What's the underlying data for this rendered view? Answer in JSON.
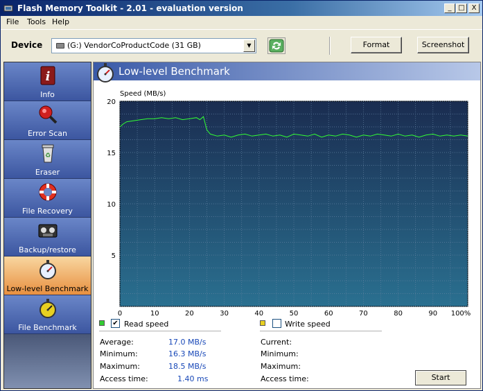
{
  "window": {
    "title": "Flash Memory Toolkit - 2.01 - evaluation version",
    "controls": [
      "_",
      "□",
      "X"
    ]
  },
  "menu": [
    "File",
    "Tools",
    "Help"
  ],
  "toolbar": {
    "device_label": "Device",
    "device_value": "(G:) VendorCoProductCode (31 GB)",
    "format_label": "Format",
    "screenshot_label": "Screenshot"
  },
  "sidebar": {
    "items": [
      {
        "label": "Info",
        "icon": "info-icon"
      },
      {
        "label": "Error Scan",
        "icon": "magnifier-icon"
      },
      {
        "label": "Eraser",
        "icon": "recycle-bin-icon"
      },
      {
        "label": "File Recovery",
        "icon": "lifebuoy-icon"
      },
      {
        "label": "Backup/restore",
        "icon": "tape-icon"
      },
      {
        "label": "Low-level Benchmark",
        "icon": "stopwatch-icon",
        "active": true
      },
      {
        "label": "File Benchmark",
        "icon": "stopwatch-yellow-icon"
      }
    ]
  },
  "section": {
    "title": "Low-level Benchmark"
  },
  "chart_data": {
    "type": "line",
    "ylabel": "Speed (MB/s)",
    "xlabel": "",
    "ylim": [
      0,
      20
    ],
    "xlim": [
      0,
      100
    ],
    "yticks": [
      5,
      10,
      15,
      20
    ],
    "xticks": [
      "0",
      "10",
      "20",
      "30",
      "40",
      "50",
      "60",
      "70",
      "80",
      "90",
      "100%"
    ],
    "series": [
      {
        "name": "Read speed",
        "color": "#33ff33",
        "x": [
          0,
          1,
          2,
          4,
          6,
          8,
          10,
          12,
          14,
          16,
          18,
          20,
          22,
          23,
          24,
          25,
          26,
          28,
          30,
          32,
          34,
          36,
          38,
          40,
          42,
          44,
          46,
          48,
          50,
          52,
          54,
          56,
          58,
          60,
          62,
          64,
          66,
          68,
          70,
          72,
          74,
          76,
          78,
          80,
          82,
          84,
          86,
          88,
          90,
          92,
          94,
          96,
          98,
          100
        ],
        "y": [
          17.5,
          17.8,
          18.0,
          18.1,
          18.2,
          18.3,
          18.3,
          18.4,
          18.3,
          18.4,
          18.2,
          18.3,
          18.4,
          18.2,
          18.5,
          17.2,
          16.8,
          16.6,
          16.7,
          16.5,
          16.7,
          16.8,
          16.6,
          16.7,
          16.8,
          16.6,
          16.7,
          16.5,
          16.8,
          16.7,
          16.6,
          16.8,
          16.5,
          16.7,
          16.6,
          16.8,
          16.7,
          16.5,
          16.7,
          16.6,
          16.8,
          16.7,
          16.6,
          16.8,
          16.6,
          16.7,
          16.5,
          16.7,
          16.8,
          16.6,
          16.7,
          16.6,
          16.7,
          16.6
        ]
      }
    ],
    "background": "#1a3558",
    "grid": true
  },
  "read": {
    "label": "Read speed",
    "checked": true,
    "swatch": "#33cc33",
    "stats": [
      {
        "label": "Average:",
        "value": "17.0 MB/s"
      },
      {
        "label": "Minimum:",
        "value": "16.3 MB/s"
      },
      {
        "label": "Maximum:",
        "value": "18.5 MB/s"
      },
      {
        "label": "Access time:",
        "value": "1.40 ms"
      }
    ]
  },
  "write": {
    "label": "Write speed",
    "checked": false,
    "swatch": "#e8d020",
    "stats": [
      {
        "label": "Current:",
        "value": ""
      },
      {
        "label": "Minimum:",
        "value": ""
      },
      {
        "label": "Maximum:",
        "value": ""
      },
      {
        "label": "Access time:",
        "value": ""
      }
    ]
  },
  "start_label": "Start"
}
